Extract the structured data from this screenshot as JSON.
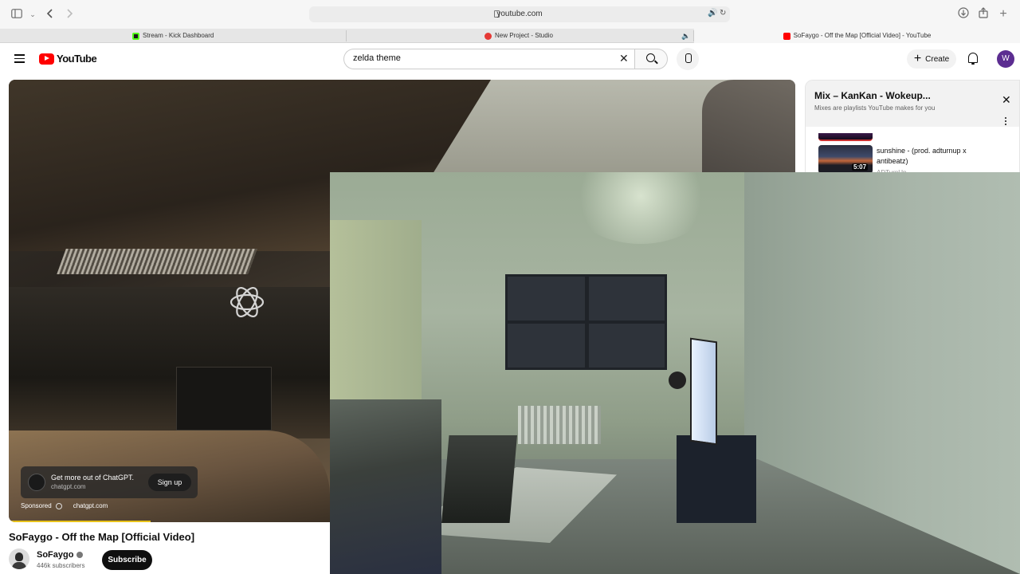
{
  "browser": {
    "url": "youtube.com",
    "tabs": [
      {
        "title": "Stream - Kick Dashboard",
        "favicon_color": "#53fc18"
      },
      {
        "title": "New Project - Studio",
        "favicon_color": "#e53935"
      },
      {
        "title": "SoFaygo - Off the Map [Official Video] - YouTube",
        "favicon_color": "#ff0000"
      }
    ],
    "icons": [
      "sidebar-icon",
      "chevron-down-icon",
      "back-icon",
      "forward-icon",
      "lock-icon",
      "audio-icon",
      "reload-icon",
      "download-icon",
      "share-icon",
      "new-tab-icon",
      "mute-icon"
    ]
  },
  "youtube": {
    "logo_text": "YouTube",
    "search": {
      "value": "zelda theme",
      "clear_label": "✕"
    },
    "create_label": "Create",
    "avatar_letter": "W",
    "accent": "#ff0000"
  },
  "ad": {
    "title": "Get more out of ChatGPT.",
    "domain": "chatgpt.com",
    "cta": "Sign up",
    "sponsored_label": "Sponsored",
    "meta_domain": "chatgpt.com",
    "progress_fraction": 0.18,
    "progress_color": "#e8c21a"
  },
  "video": {
    "title": "SoFaygo - Off the Map [Official Video]",
    "channel": "SoFaygo",
    "subscribers": "446k subscribers",
    "subscribe_label": "Subscribe"
  },
  "mix": {
    "title": "Mix – KanKan - Wokeup...",
    "subtitle": "Mixes are playlists YouTube makes for you",
    "items": [
      {
        "title": "sunshine - (prod. adturnup x antibeatz)",
        "duration": "5:07",
        "channel": "ADTurnUp"
      }
    ]
  }
}
